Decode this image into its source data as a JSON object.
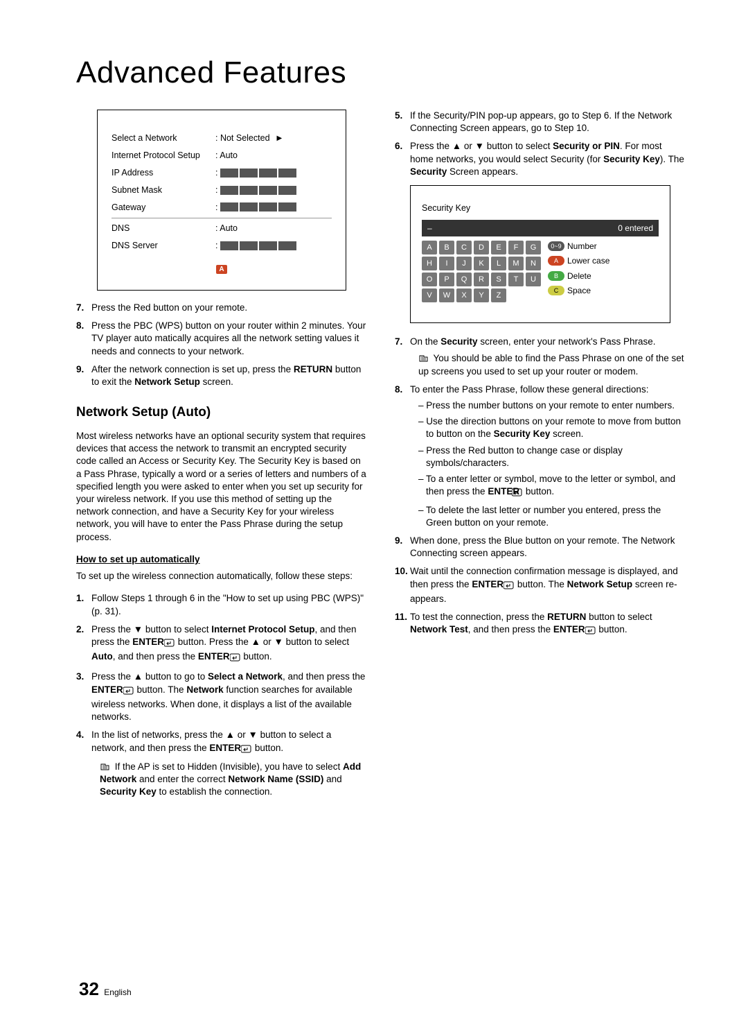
{
  "title": "Advanced Features",
  "panel": {
    "rows": [
      {
        "label": "Select a Network",
        "value": ": Not Selected",
        "arrow": true
      },
      {
        "label": "Internet Protocol Setup",
        "value": ": Auto"
      },
      {
        "label": "IP Address",
        "boxes": true
      },
      {
        "label": "Subnet Mask",
        "boxes": true
      },
      {
        "label": "Gateway",
        "boxes": true
      },
      {
        "label": "DNS",
        "value": ": Auto",
        "top": true
      },
      {
        "label": "DNS Server",
        "boxes": true
      }
    ],
    "badge": "A"
  },
  "left_steps_a": [
    {
      "n": "7.",
      "t": "Press the Red button on your remote."
    },
    {
      "n": "8.",
      "t": "Press the PBC (WPS) button on your router within 2 minutes. Your TV player auto matically acquires all the network setting values it needs and connects to your network."
    },
    {
      "n": "9.",
      "pre": "After the network connection is set up, press the ",
      "b1": "RETURN",
      "mid": " button to exit the ",
      "b2": "Network Setup",
      "post": " screen."
    }
  ],
  "auto_heading": "Network Setup (Auto)",
  "auto_body": "Most wireless networks have an optional security system that requires devices that access the network to transmit an encrypted security code called an Access or Security Key. The Security Key is based on a Pass Phrase, typically a word or a series of letters and numbers of a specified length you were asked to enter when you set up security for your wireless network.  If you use this method of setting up the network connection, and have a Security Key for your wireless network, you will have to enter the Pass Phrase during the setup process.",
  "howto_h": "How to set up automatically",
  "howto_intro": "To set up the wireless connection automatically, follow these steps:",
  "left_steps_b": {
    "s1": {
      "n": "1.",
      "t": "Follow Steps 1 through 6 in the \"How to set up using PBC (WPS)\" (p. 31)."
    },
    "s2": {
      "n": "2.",
      "p1": "Press the ▼ button to select ",
      "b1": "Internet Protocol Setup",
      "p2": ", and then press the ",
      "b2": "ENTER",
      "p3": " button. Press the ▲ or ▼ button to select ",
      "b3": "Auto",
      "p4": ", and then press the ",
      "b4": "ENTER",
      "p5": " button."
    },
    "s3": {
      "n": "3.",
      "p1": "Press the ▲ button to go to ",
      "b1": "Select a Network",
      "p2": ", and then press the ",
      "b2": "ENTER",
      "p3": " button. The ",
      "b3": "Network",
      "p4": " function searches for available wireless networks. When done, it displays a list of the available networks."
    },
    "s4": {
      "n": "4.",
      "p1": "In the list of networks, press the ▲ or ▼ button to select a network, and then press the ",
      "b1": "ENTER",
      "p2": " button.",
      "note": {
        "p1": "If the AP is set to Hidden (Invisible), you have to select ",
        "b1": "Add Network",
        "p2": " and enter the correct ",
        "b2": "Network Name (SSID)",
        "p3": " and ",
        "b3": "Security Key",
        "p4": " to establish the connection."
      }
    }
  },
  "right_steps_a": {
    "s5": {
      "n": "5.",
      "t": "If the Security/PIN pop-up appears, go to Step 6. If the Network Connecting Screen appears, go to Step 10."
    },
    "s6": {
      "n": "6.",
      "p1": "Press the ▲ or ▼ button to select ",
      "b1": "Security or PIN",
      "p2": ". For most home networks, you would select Security (for ",
      "b2": "Security Key",
      "p3": "). The ",
      "b3": "Security",
      "p4": " Screen appears."
    }
  },
  "sec_panel": {
    "title": "Security Key",
    "entered": "0 entered",
    "legend": {
      "num": "Number",
      "lower": "Lower case",
      "del": "Delete",
      "space": "Space"
    },
    "num_badge": "0~9",
    "a_badge": "A",
    "b_badge": "B",
    "c_badge": "C",
    "rows": [
      [
        "A",
        "B",
        "C",
        "D",
        "E",
        "F",
        "G"
      ],
      [
        "H",
        "I",
        "J",
        "K",
        "L",
        "M",
        "N"
      ],
      [
        "O",
        "P",
        "Q",
        "R",
        "S",
        "T",
        "U"
      ],
      [
        "V",
        "W",
        "X",
        "Y",
        "Z",
        "",
        ""
      ]
    ]
  },
  "right_steps_b": {
    "s7": {
      "n": "7.",
      "p1": "On the ",
      "b1": "Security",
      "p2": " screen, enter your network's Pass Phrase.",
      "note": "You should be able to find the Pass Phrase on one of the set up screens you used to set up your router or modem."
    },
    "s8": {
      "n": "8.",
      "t": "To enter the Pass Phrase, follow these general directions:",
      "d1": "Press the number buttons on your remote to enter numbers.",
      "d2p1": "Use the direction buttons on your remote to move from button to button on the ",
      "d2b": "Security Key",
      "d2p2": " screen.",
      "d3": "Press the Red button to change case or display symbols/characters.",
      "d4p1": "To a enter letter or symbol, move to the letter or symbol, and then press the ",
      "d4b": "ENTER",
      "d4p2": " button.",
      "d5": "To delete the last letter or number you entered, press the Green button on your remote."
    },
    "s9": {
      "n": "9.",
      "t": "When done, press the Blue button on your remote. The Network Connecting screen appears."
    },
    "s10": {
      "n": "10.",
      "p1": "Wait until the connection confirmation message is displayed, and then press the ",
      "b1": "ENTER",
      "p2": " button. The ",
      "b2": "Network Setup",
      "p3": " screen re-appears."
    },
    "s11": {
      "n": "11.",
      "p1": "To test the connection, press the ",
      "b1": "RETURN",
      "p2": " button to select ",
      "b2": "Network Test",
      "p3": ", and then press the ",
      "b3": "ENTER",
      "p4": " button."
    }
  },
  "footer": {
    "page": "32",
    "lang": "English"
  }
}
